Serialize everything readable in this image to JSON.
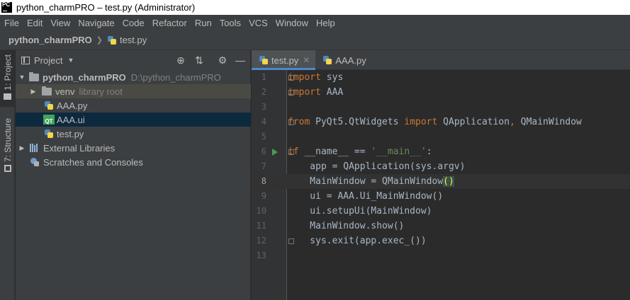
{
  "window": {
    "title": "python_charmPRO – test.py (Administrator)",
    "app_icon_text": "PC"
  },
  "menu": [
    "File",
    "Edit",
    "View",
    "Navigate",
    "Code",
    "Refactor",
    "Run",
    "Tools",
    "VCS",
    "Window",
    "Help"
  ],
  "navbar": {
    "project": "python_charmPRO",
    "file": "test.py"
  },
  "toolstrip": {
    "project_tab": "1: Project",
    "structure_tab": "7: Structure"
  },
  "project_panel": {
    "title": "Project",
    "tree": [
      {
        "label": "python_charmPRO",
        "detail": "D:\\python_charmPRO"
      },
      {
        "label": "venv",
        "detail": "library root"
      },
      {
        "label": "AAA.py"
      },
      {
        "label": "AAA.ui"
      },
      {
        "label": "test.py"
      },
      {
        "label": "External Libraries"
      },
      {
        "label": "Scratches and Consoles"
      }
    ]
  },
  "editor": {
    "tabs": [
      {
        "label": "test.py",
        "active": true
      },
      {
        "label": "AAA.py",
        "active": false
      }
    ],
    "current_line": 8,
    "lines": [
      "import sys",
      "import AAA",
      "",
      "from PyQt5.QtWidgets import QApplication, QMainWindow",
      "",
      "if __name__ == '__main__':",
      "    app = QApplication(sys.argv)",
      "    MainWindow = QMainWindow()",
      "    ui = AAA.Ui_MainWindow()",
      "    ui.setupUi(MainWindow)",
      "    MainWindow.show()",
      "    sys.exit(app.exec_())",
      ""
    ]
  },
  "colors": {
    "keyword": "#cc7832",
    "string": "#6a8759",
    "identifier": "#a9b7c6",
    "selection": "#0d293e",
    "tab_accent": "#4a88c7"
  }
}
